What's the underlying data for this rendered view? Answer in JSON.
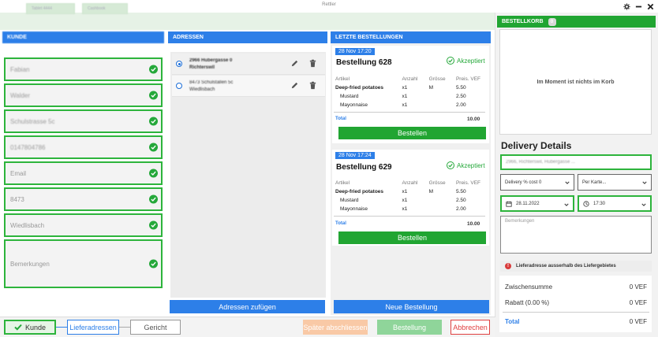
{
  "window": {
    "title": "Rettler"
  },
  "topstrip": {
    "chips": [
      "Tablet 4444",
      "Cashbook"
    ]
  },
  "kunde": {
    "header": "KUNDE",
    "fields": [
      {
        "value": "Fabian",
        "blurred": true
      },
      {
        "value": "Walder",
        "blurred": true
      },
      {
        "value": "Schulstrasse 5c",
        "blurred": true
      },
      {
        "value": "0147804786",
        "blurred": true
      },
      {
        "value": "Email",
        "blurred": false
      },
      {
        "value": "8473",
        "blurred": false
      },
      {
        "value": "Wiedlisbach",
        "blurred": false
      },
      {
        "value": "Bemerkungen",
        "blurred": false
      }
    ]
  },
  "adressen": {
    "header": "ADRESSEN",
    "items": [
      {
        "line1": "2966 Hubergasse 0",
        "line2": "Richterswil"
      },
      {
        "line1": "8473 Schulstallen 5c",
        "line2": "Wiedlisbach"
      }
    ],
    "add_label": "Adressen zufügen"
  },
  "orders": {
    "header": "LETZTE BESTELLUNGEN",
    "columns": [
      "Artikel",
      "Anzahl",
      "Grösse",
      "Preis. VEF"
    ],
    "list": [
      {
        "date": "28 Nov 17:20",
        "title": "Bestellung 628",
        "status": "Akzeptiert",
        "items": [
          {
            "name": "Deep-fried potatoes",
            "qty": "x1",
            "size": "M",
            "price": "5.50",
            "bold": true
          },
          {
            "name": "Mustard",
            "qty": "x1",
            "size": "",
            "price": "2.50",
            "bold": false
          },
          {
            "name": "Mayonnaise",
            "qty": "x1",
            "size": "",
            "price": "2.00",
            "bold": false
          }
        ],
        "total_label": "Total",
        "total": "10.00",
        "button": "Bestellen"
      },
      {
        "date": "28 Nov 17:24",
        "title": "Bestellung 629",
        "status": "Akzeptiert",
        "items": [
          {
            "name": "Deep-fried potatoes",
            "qty": "x1",
            "size": "M",
            "price": "5.50",
            "bold": true
          },
          {
            "name": "Mustard",
            "qty": "x1",
            "size": "",
            "price": "2.50",
            "bold": false
          },
          {
            "name": "Mayonnaise",
            "qty": "x1",
            "size": "",
            "price": "2.00",
            "bold": false
          }
        ],
        "total_label": "Total",
        "total": "10.00",
        "button": "Bestellen"
      }
    ],
    "new_label": "Neue Bestellung"
  },
  "cart": {
    "header": "BESTELLKORB",
    "count": "0",
    "empty_text": "Im Moment ist nichts im Korb"
  },
  "delivery": {
    "title": "Delivery Details",
    "address_value": "2966, Richterswil, Hubergasse ...",
    "delivery_select": "Delivery % cost 0",
    "payment_select": "Per Karte...",
    "date": "28.11.2022",
    "time": "17:30",
    "remarks_placeholder": "Bemerkungen",
    "warning": "Lieferadresse ausserhalb des Liefergebietes"
  },
  "summary": {
    "subtotal_label": "Zwischensumme",
    "subtotal": "0 VEF",
    "discount_label": "Rabatt (0.00 %)",
    "discount": "0 VEF",
    "total_label": "Total",
    "total": "0 VEF"
  },
  "bottom": {
    "steps": [
      "Kunde",
      "Lieferadressen",
      "Gericht"
    ],
    "actions": [
      "Später abschliessen",
      "Bestellung",
      "Abbrechen"
    ]
  },
  "colors": {
    "blue": "#2d7fe8",
    "green": "#21a532",
    "red": "#e04040",
    "orange": "#f5b98a"
  }
}
